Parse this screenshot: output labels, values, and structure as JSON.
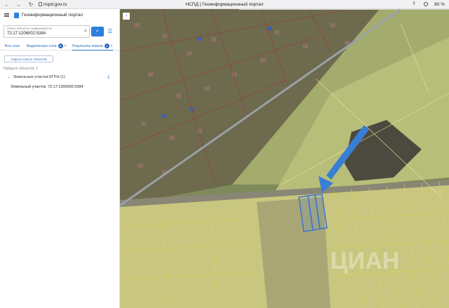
{
  "browser": {
    "url": "nspd.gov.ru",
    "page_title": "НСПД | Геоинформационный портал",
    "zoom": "80 %"
  },
  "app": {
    "title": "Геоинформационный портал"
  },
  "search": {
    "label": "Поиск Объекты недвижимости",
    "value": "72:17:1206002:5384"
  },
  "tabs": [
    {
      "label": "Все слои"
    },
    {
      "label": "Выделенные слои",
      "badge": "0"
    },
    {
      "label": "Результаты поиска",
      "badge": "1"
    }
  ],
  "results": {
    "show_list_button": "Скрыть список объектов",
    "found_text": "Найдено объектов: 1",
    "group_label": "Земельные участки ЕГРН (1)",
    "item_label": "Земельный участок: 72:17:1206002:5384"
  },
  "map": {
    "watermark": "ЦИАН"
  }
}
